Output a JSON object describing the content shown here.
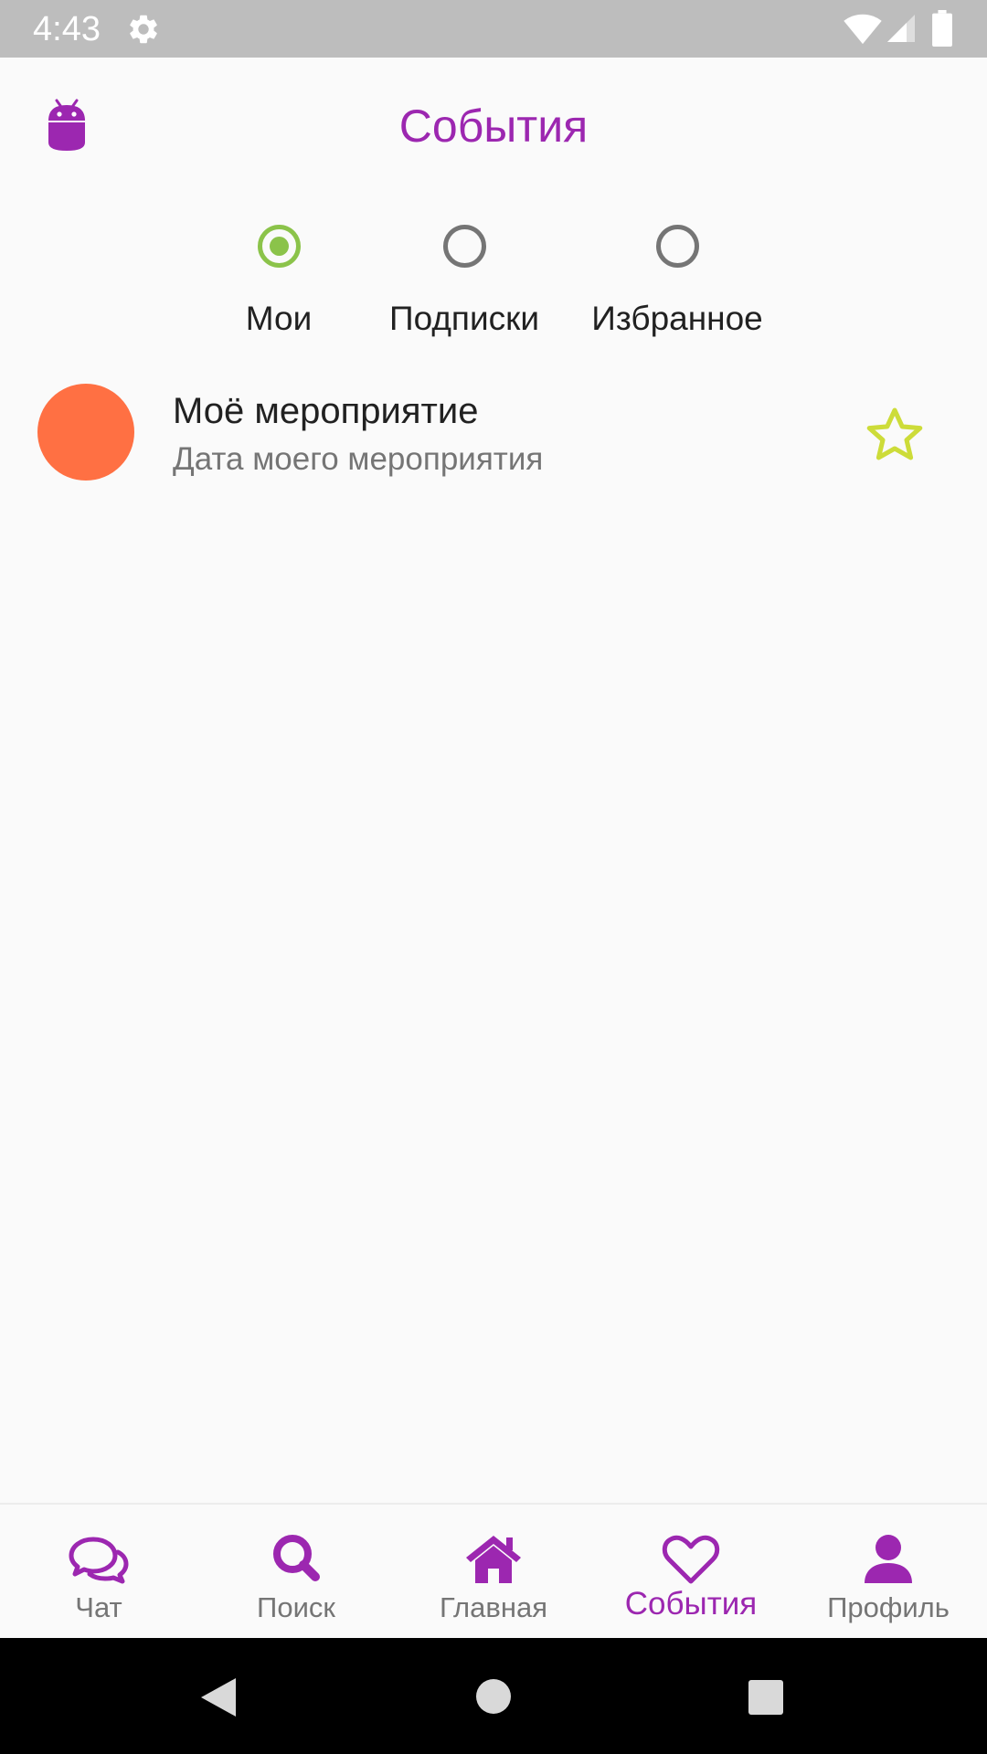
{
  "status_bar": {
    "time": "4:43",
    "icons": [
      "settings-icon",
      "wifi-icon",
      "signal-icon",
      "battery-icon"
    ]
  },
  "header": {
    "title": "События",
    "logo_icon": "android-icon"
  },
  "filter": {
    "options": [
      {
        "label": "Мои",
        "selected": true
      },
      {
        "label": "Подписки",
        "selected": false
      },
      {
        "label": "Избранное",
        "selected": false
      }
    ]
  },
  "events": [
    {
      "title": "Моё мероприятие",
      "date": "Дата моего мероприятия",
      "avatar_color": "#ff7043",
      "favorite_icon": "star-outline-icon"
    }
  ],
  "bottom_nav": {
    "items": [
      {
        "label": "Чат",
        "icon": "chat-icon"
      },
      {
        "label": "Поиск",
        "icon": "search-icon"
      },
      {
        "label": "Главная",
        "icon": "home-icon"
      },
      {
        "label": "События",
        "icon": "heart-icon",
        "active": true
      },
      {
        "label": "Профиль",
        "icon": "user-icon"
      }
    ]
  },
  "colors": {
    "accent": "#9c27b0",
    "radio_selected": "#8bc34a",
    "star": "#cddc39",
    "avatar": "#ff7043"
  }
}
